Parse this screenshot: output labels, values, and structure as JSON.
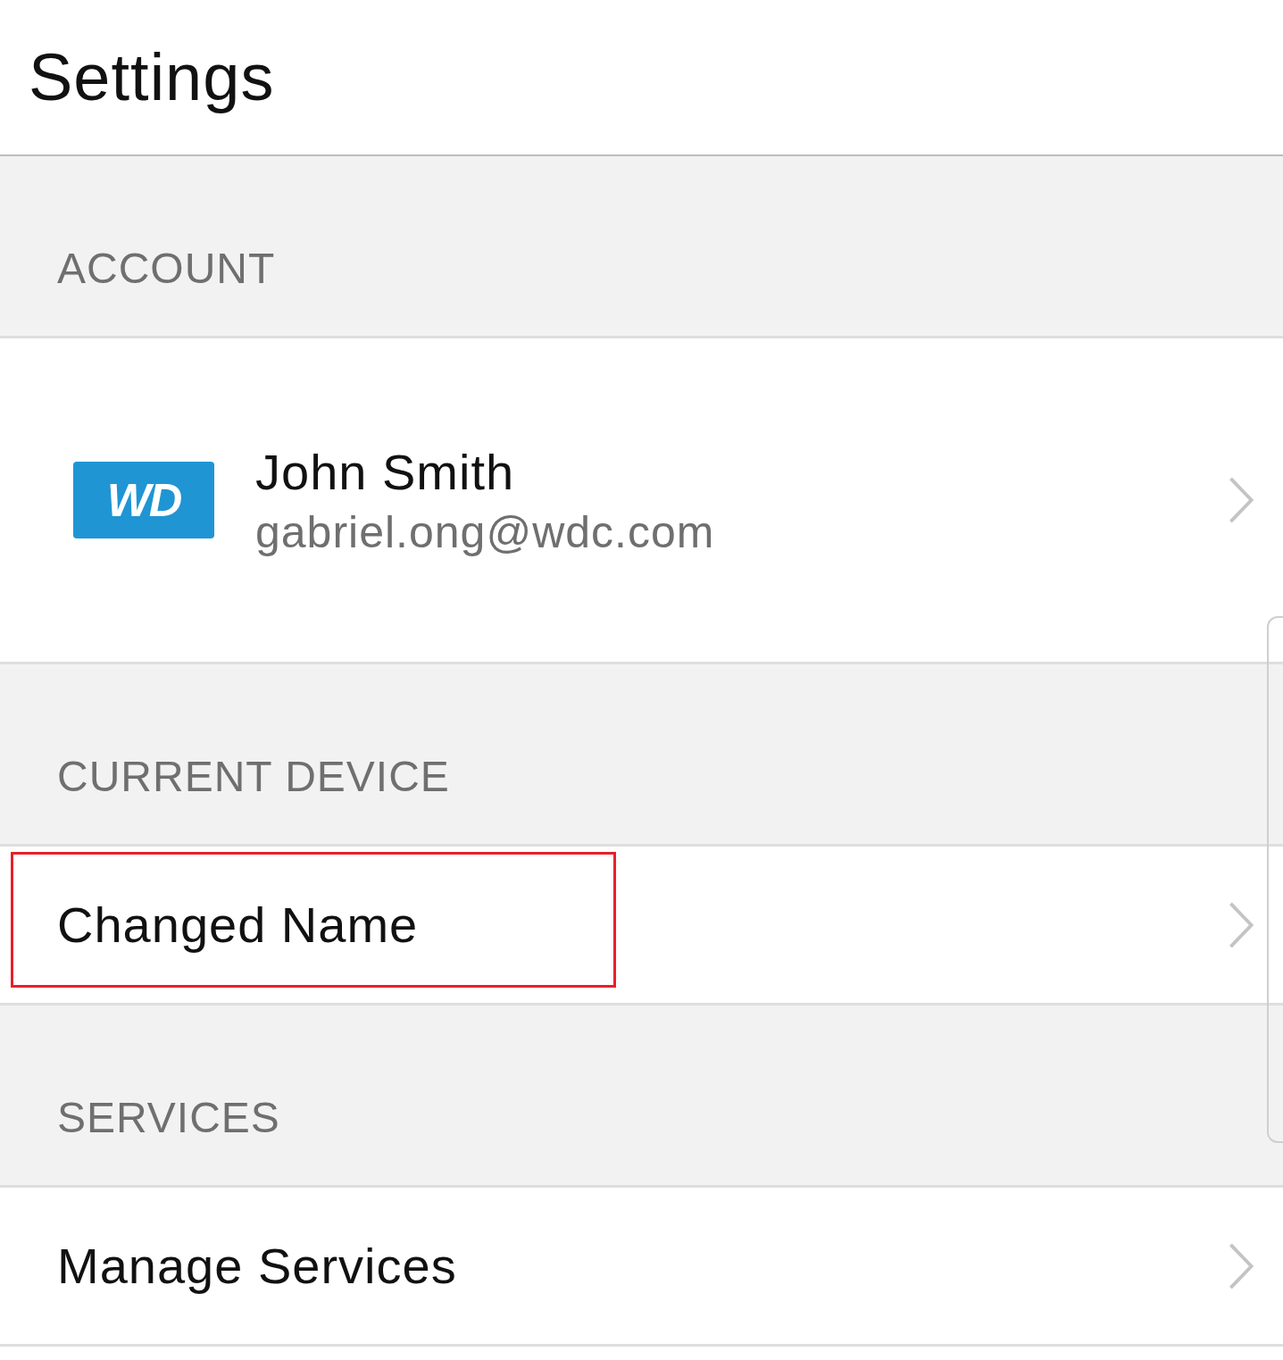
{
  "header": {
    "title": "Settings"
  },
  "sections": [
    {
      "heading": "ACCOUNT",
      "rows": [
        {
          "kind": "account",
          "logo": "WD",
          "name": "John Smith",
          "email": "gabriel.ong@wdc.com",
          "highlighted": false
        }
      ]
    },
    {
      "heading": "CURRENT DEVICE",
      "rows": [
        {
          "kind": "plain",
          "label": "Changed Name",
          "highlighted": true
        }
      ]
    },
    {
      "heading": "SERVICES",
      "rows": [
        {
          "kind": "plain",
          "label": "Manage Services",
          "highlighted": false
        }
      ]
    }
  ]
}
